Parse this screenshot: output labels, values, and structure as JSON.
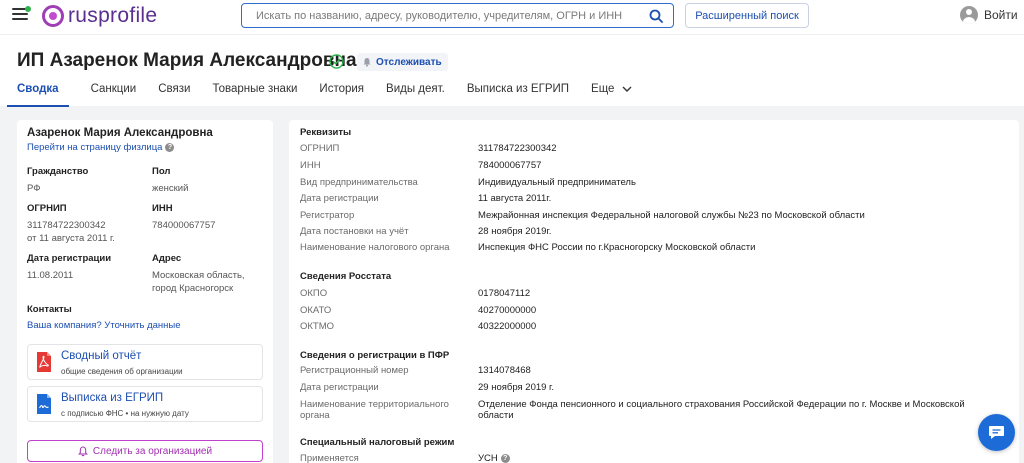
{
  "header": {
    "logo_text": "rusprofile",
    "search_placeholder": "Искать по названию, адресу, руководителю, учредителям, ОГРН и ИНН",
    "advanced_search_label": "Расширенный поиск",
    "login_label": "Войти"
  },
  "title": {
    "name": "ИП Азаренок Мария Александровна",
    "follow_label": "Отслеживать"
  },
  "tabs": [
    {
      "label": "Сводка"
    },
    {
      "label": "Санкции"
    },
    {
      "label": "Связи"
    },
    {
      "label": "Товарные знаки"
    },
    {
      "label": "История"
    },
    {
      "label": "Виды деят."
    },
    {
      "label": "Выписка из ЕГРИП"
    },
    {
      "label": "Еще"
    }
  ],
  "summary": {
    "person_name": "Азаренок Мария Александровна",
    "person_link": "Перейти на страницу физлица",
    "citizenship_label": "Гражданство",
    "citizenship_value": "РФ",
    "gender_label": "Пол",
    "gender_value": "женский",
    "ogrnip_label": "ОГРНИП",
    "ogrnip_value": "311784722300342",
    "ogrnip_date": "от 11 августа 2011 г.",
    "inn_label": "ИНН",
    "inn_value": "784000067757",
    "reg_date_label": "Дата регистрации",
    "reg_date_value": "11.08.2011",
    "address_label": "Адрес",
    "address_line1": "Московская область,",
    "address_line2": "город Красногорск",
    "contacts_label": "Контакты",
    "contacts_link": "Ваша компания? Уточнить данные",
    "report_title": "Сводный отчёт",
    "report_sub": "общие сведения об организации",
    "extract_title": "Выписка из ЕГРИП",
    "extract_sub": "с подписью ФНС • на нужную дату",
    "watch_label": "Следить за организацией"
  },
  "details": {
    "requisites_title": "Реквизиты",
    "requisites": [
      {
        "key": "ОГРНИП",
        "value": "311784722300342"
      },
      {
        "key": "ИНН",
        "value": "784000067757"
      },
      {
        "key": "Вид предпринимательства",
        "value": "Индивидуальный предприниматель"
      },
      {
        "key": "Дата регистрации",
        "value": "11 августа 2011г."
      },
      {
        "key": "Регистратор",
        "value": "Межрайонная инспекция Федеральной налоговой службы №23 по Московской области"
      },
      {
        "key": "Дата постановки на учёт",
        "value": "28 ноября 2019г."
      },
      {
        "key": "Наименование налогового органа",
        "value": "Инспекция ФНС России по г.Красногорску Московской области"
      }
    ],
    "rosstat_title": "Сведения Росстата",
    "rosstat": [
      {
        "key": "ОКПО",
        "value": "0178047112"
      },
      {
        "key": "ОКАТО",
        "value": "40270000000"
      },
      {
        "key": "ОКТМО",
        "value": "40322000000"
      }
    ],
    "pfr_title": "Сведения о регистрации в ПФР",
    "pfr": [
      {
        "key": "Регистрационный номер",
        "value": "1314078468"
      },
      {
        "key": "Дата регистрации",
        "value": "29 ноября 2019 г."
      }
    ],
    "pfr_org_key_line1": "Наименование территориального",
    "pfr_org_key_line2": "органа",
    "pfr_org_value_line1": "Отделение Фонда пенсионного и социального страхования Российской Федерации по г. Москве и Московской",
    "pfr_org_value_line2": "области",
    "tax_title": "Специальный налоговый режим",
    "tax_key": "Применяется",
    "tax_value": "УСН"
  },
  "icons": {
    "menu": "menu-icon",
    "search": "search-icon",
    "user": "user-icon",
    "verified": "check-circle-icon",
    "bell": "bell-icon",
    "pdf": "pdf-icon",
    "doc": "doc-icon",
    "chat": "chat-icon"
  },
  "colors": {
    "brand": "#5b2f8e",
    "link": "#1c4fb0",
    "accent_purple": "#c041cc",
    "chat_blue": "#1c6bd6",
    "verified_green": "#2fb24c"
  }
}
